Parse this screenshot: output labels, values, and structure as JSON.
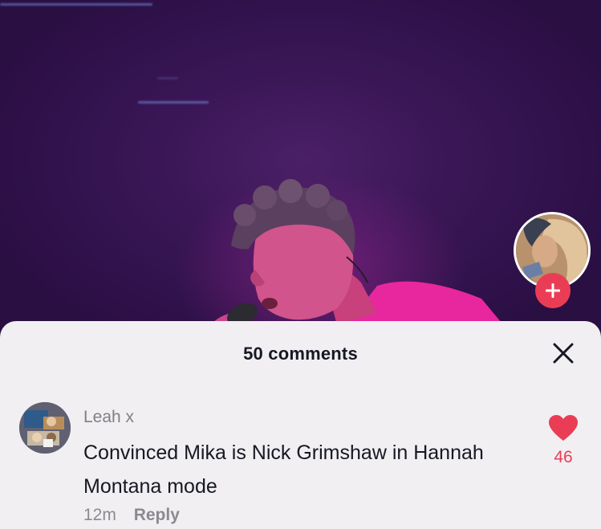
{
  "video": {
    "creator_avatar_icon": "creator-avatar-photo",
    "follow_icon": "plus-icon"
  },
  "comments_sheet": {
    "title": "50 comments",
    "close_icon": "close-icon"
  },
  "comments": [
    {
      "author": "Leah x",
      "text": "Convinced Mika is Nick Grimshaw in Hannah Montana mode",
      "time": "12m",
      "reply_label": "Reply",
      "like_icon": "heart-icon",
      "likes": "46",
      "liked": true
    }
  ],
  "colors": {
    "accent": "#ea3d55",
    "sheet_background": "#f1eff2",
    "primary_text": "#161823",
    "secondary_text": "#8a8a90"
  }
}
